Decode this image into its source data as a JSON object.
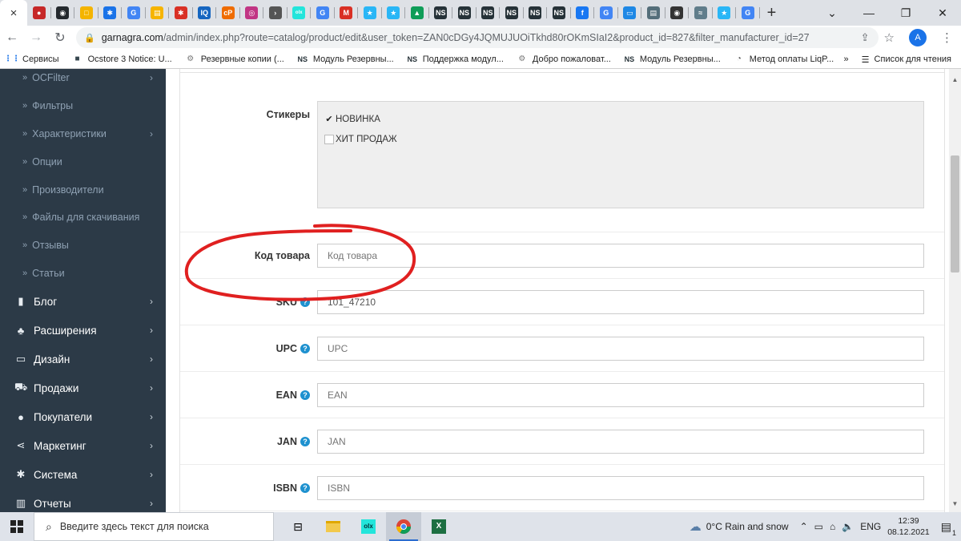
{
  "browser": {
    "active_tab_close": "×",
    "new_tab": "+",
    "tab_favicons": [
      {
        "icon": "red-bird-icon",
        "color": "#c62828",
        "text": "●"
      },
      {
        "icon": "github-icon",
        "color": "#24292e",
        "text": "◉"
      },
      {
        "icon": "yellow-app-icon",
        "color": "#f4b400",
        "text": "□"
      },
      {
        "icon": "gear-icon",
        "color": "#1a73e8",
        "text": "✱"
      },
      {
        "icon": "google-icon",
        "color": "#4285f4",
        "text": "G"
      },
      {
        "icon": "slides-icon",
        "color": "#f6b400",
        "text": "▤"
      },
      {
        "icon": "settings-icon",
        "color": "#d93025",
        "text": "✱"
      },
      {
        "icon": "iq-icon",
        "color": "#1565c0",
        "text": "IQ"
      },
      {
        "icon": "cp-icon",
        "color": "#ef6c00",
        "text": "cP"
      },
      {
        "icon": "instagram-icon",
        "color": "#c13584",
        "text": "◎"
      },
      {
        "icon": "arrow-circle-icon",
        "color": "#555555",
        "text": "›"
      },
      {
        "icon": "olx-icon",
        "color": "#23e5db",
        "text": "olx"
      },
      {
        "icon": "google-icon",
        "color": "#4285f4",
        "text": "G"
      },
      {
        "icon": "gmail-icon",
        "color": "#d93025",
        "text": "M"
      },
      {
        "icon": "star-app-icon",
        "color": "#29b6f6",
        "text": "★"
      },
      {
        "icon": "star-app-icon",
        "color": "#29b6f6",
        "text": "★"
      },
      {
        "icon": "drive-icon",
        "color": "#0f9d58",
        "text": "▲"
      },
      {
        "icon": "ns-icon",
        "color": "#263238",
        "text": "NS"
      },
      {
        "icon": "ns-icon",
        "color": "#263238",
        "text": "NS"
      },
      {
        "icon": "ns-icon",
        "color": "#263238",
        "text": "NS"
      },
      {
        "icon": "ns-icon",
        "color": "#263238",
        "text": "NS"
      },
      {
        "icon": "ns-icon",
        "color": "#263238",
        "text": "NS"
      },
      {
        "icon": "ns-icon",
        "color": "#263238",
        "text": "NS"
      },
      {
        "icon": "facebook-icon",
        "color": "#1877f2",
        "text": "f"
      },
      {
        "icon": "google-icon",
        "color": "#4285f4",
        "text": "G"
      },
      {
        "icon": "monitor-icon",
        "color": "#1e88e5",
        "text": "▭"
      },
      {
        "icon": "docs-icon",
        "color": "#546e7a",
        "text": "▤"
      },
      {
        "icon": "chrome-icon",
        "color": "#333333",
        "text": "◉"
      },
      {
        "icon": "wifi-pin-icon",
        "color": "#607d8b",
        "text": "≈"
      },
      {
        "icon": "star-app-icon",
        "color": "#29b6f6",
        "text": "★"
      },
      {
        "icon": "google-icon",
        "color": "#4285f4",
        "text": "G"
      }
    ],
    "window_controls": [
      "⌄",
      "—",
      "❐",
      "✕"
    ],
    "url_host": "garnagra.com",
    "url_path": "/admin/index.php?route=catalog/product/edit&user_token=ZAN0cDGy4JQMUJUOiTkhd80rOKmSIaI2&product_id=827&filter_manufacturer_id=27",
    "avatar_letter": "A",
    "bookmarks": [
      {
        "icon": "apps-grid-icon",
        "label": "Сервисы"
      },
      {
        "icon": "ocstore-icon",
        "label": "Ocstore 3 Notice: U..."
      },
      {
        "icon": "backup-icon",
        "label": "Резервные копии (..."
      },
      {
        "icon": "ns-icon",
        "label": "Модуль Резервны..."
      },
      {
        "icon": "ns-icon",
        "label": "Поддержка модул..."
      },
      {
        "icon": "backup-icon",
        "label": "Добро пожаловат..."
      },
      {
        "icon": "ns-icon",
        "label": "Модуль Резервны..."
      },
      {
        "icon": "liqpay-icon",
        "label": "Метод оплаты LiqP..."
      }
    ],
    "bookmarks_more": "»",
    "reading_list": "Список для чтения"
  },
  "sidebar": {
    "sub_items": [
      {
        "label": "OCFilter",
        "has_chevron": true
      },
      {
        "label": "Фильтры",
        "has_chevron": false
      },
      {
        "label": "Характеристики",
        "has_chevron": true
      },
      {
        "label": "Опции",
        "has_chevron": false
      },
      {
        "label": "Производители",
        "has_chevron": false
      },
      {
        "label": "Файлы для скачивания",
        "has_chevron": false
      },
      {
        "label": "Отзывы",
        "has_chevron": false
      },
      {
        "label": "Статьи",
        "has_chevron": false
      }
    ],
    "main_items": [
      {
        "icon": "book-icon",
        "label": "Блог"
      },
      {
        "icon": "puzzle-icon",
        "label": "Расширения"
      },
      {
        "icon": "desktop-icon",
        "label": "Дизайн"
      },
      {
        "icon": "cart-icon",
        "label": "Продажи"
      },
      {
        "icon": "user-icon",
        "label": "Покупатели"
      },
      {
        "icon": "share-icon",
        "label": "Маркетинг"
      },
      {
        "icon": "cog-icon",
        "label": "Система"
      },
      {
        "icon": "bar-chart-icon",
        "label": "Отчеты"
      }
    ]
  },
  "form": {
    "stickers_label": "Стикеры",
    "stickers": [
      {
        "label": "НОВИНКА",
        "checked": true
      },
      {
        "label": "ХИТ ПРОДАЖ",
        "checked": false
      }
    ],
    "fields": [
      {
        "label": "Код товара",
        "help": false,
        "value": "",
        "placeholder": "Код товара"
      },
      {
        "label": "SKU",
        "help": true,
        "value": "101_47210",
        "placeholder": ""
      },
      {
        "label": "UPC",
        "help": true,
        "value": "",
        "placeholder": "UPC"
      },
      {
        "label": "EAN",
        "help": true,
        "value": "",
        "placeholder": "EAN"
      },
      {
        "label": "JAN",
        "help": true,
        "value": "",
        "placeholder": "JAN"
      },
      {
        "label": "ISBN",
        "help": true,
        "value": "",
        "placeholder": "ISBN"
      }
    ],
    "help_glyph": "?",
    "annotation_color": "#e02020"
  },
  "taskbar": {
    "search_placeholder": "Введите здесь текст для поиска",
    "weather": "0°C  Rain and snow",
    "language": "ENG",
    "time": "12:39",
    "date": "08.12.2021",
    "notifications_count": "1"
  }
}
